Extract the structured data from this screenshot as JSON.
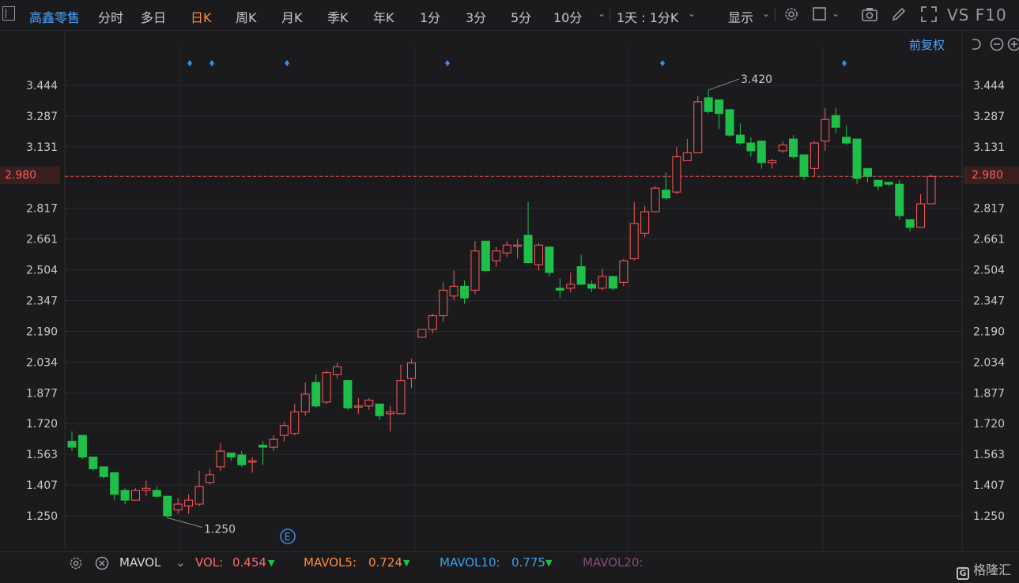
{
  "header": {
    "stock_name": "高鑫零售",
    "tabs": [
      "分时",
      "多日",
      "日K",
      "周K",
      "月K",
      "季K",
      "年K",
      "1分",
      "3分",
      "5分",
      "10分"
    ],
    "active_tab": "日K",
    "period_selector": "1天 : 1分K",
    "display_label": "显示",
    "vs_label": "VS",
    "f10_label": "F10"
  },
  "subbar": {
    "adjust_label": "前复权"
  },
  "current_price_label": "2.980",
  "markers": {
    "high_label": "3.420",
    "low_label": "1.250",
    "event_badge": "E"
  },
  "volume_bar": {
    "indicator": "MAVOL",
    "vol_label": "VOL:",
    "vol_value": "0.454",
    "mavol5_label": "MAVOL5:",
    "mavol5_value": "0.724",
    "mavol10_label": "MAVOL10:",
    "mavol10_value": "0.775",
    "mavol20_label": "MAVOL20:"
  },
  "watermark": "格隆汇",
  "colors": {
    "up": "#ff5a5a",
    "down": "#1fbf4a",
    "accent": "#ff8a3d",
    "link": "#4aa3ff"
  },
  "chart_data": {
    "type": "candlestick",
    "y_ticks": [
      "3.444",
      "3.287",
      "3.131",
      "2.980",
      "2.817",
      "2.661",
      "2.504",
      "2.347",
      "2.190",
      "2.034",
      "1.877",
      "1.720",
      "1.563",
      "1.407",
      "1.250"
    ],
    "ylim": [
      1.15,
      3.55
    ],
    "current_price": 2.98,
    "candles": [
      {
        "o": 1.63,
        "h": 1.68,
        "l": 1.58,
        "c": 1.6
      },
      {
        "o": 1.66,
        "h": 1.66,
        "l": 1.54,
        "c": 1.55
      },
      {
        "o": 1.55,
        "h": 1.55,
        "l": 1.48,
        "c": 1.49
      },
      {
        "o": 1.5,
        "h": 1.5,
        "l": 1.44,
        "c": 1.45
      },
      {
        "o": 1.47,
        "h": 1.47,
        "l": 1.33,
        "c": 1.36
      },
      {
        "o": 1.38,
        "h": 1.39,
        "l": 1.31,
        "c": 1.33
      },
      {
        "o": 1.33,
        "h": 1.39,
        "l": 1.33,
        "c": 1.38
      },
      {
        "o": 1.38,
        "h": 1.43,
        "l": 1.35,
        "c": 1.39
      },
      {
        "o": 1.38,
        "h": 1.4,
        "l": 1.34,
        "c": 1.35
      },
      {
        "o": 1.35,
        "h": 1.35,
        "l": 1.24,
        "c": 1.25
      },
      {
        "o": 1.28,
        "h": 1.34,
        "l": 1.26,
        "c": 1.31
      },
      {
        "o": 1.3,
        "h": 1.36,
        "l": 1.26,
        "c": 1.33
      },
      {
        "o": 1.31,
        "h": 1.48,
        "l": 1.3,
        "c": 1.4
      },
      {
        "o": 1.42,
        "h": 1.49,
        "l": 1.41,
        "c": 1.46
      },
      {
        "o": 1.5,
        "h": 1.62,
        "l": 1.48,
        "c": 1.58
      },
      {
        "o": 1.57,
        "h": 1.57,
        "l": 1.53,
        "c": 1.55
      },
      {
        "o": 1.56,
        "h": 1.58,
        "l": 1.5,
        "c": 1.51
      },
      {
        "o": 1.53,
        "h": 1.55,
        "l": 1.47,
        "c": 1.53
      },
      {
        "o": 1.61,
        "h": 1.63,
        "l": 1.51,
        "c": 1.6
      },
      {
        "o": 1.6,
        "h": 1.66,
        "l": 1.58,
        "c": 1.64
      },
      {
        "o": 1.66,
        "h": 1.73,
        "l": 1.63,
        "c": 1.71
      },
      {
        "o": 1.67,
        "h": 1.82,
        "l": 1.66,
        "c": 1.78
      },
      {
        "o": 1.78,
        "h": 1.93,
        "l": 1.76,
        "c": 1.87
      },
      {
        "o": 1.93,
        "h": 1.97,
        "l": 1.8,
        "c": 1.81
      },
      {
        "o": 1.83,
        "h": 1.99,
        "l": 1.82,
        "c": 1.98
      },
      {
        "o": 1.97,
        "h": 2.03,
        "l": 1.95,
        "c": 2.01
      },
      {
        "o": 1.94,
        "h": 1.94,
        "l": 1.79,
        "c": 1.8
      },
      {
        "o": 1.81,
        "h": 1.85,
        "l": 1.77,
        "c": 1.81
      },
      {
        "o": 1.81,
        "h": 1.85,
        "l": 1.79,
        "c": 1.84
      },
      {
        "o": 1.82,
        "h": 1.82,
        "l": 1.74,
        "c": 1.76
      },
      {
        "o": 1.77,
        "h": 1.81,
        "l": 1.68,
        "c": 1.78
      },
      {
        "o": 1.77,
        "h": 2.02,
        "l": 1.77,
        "c": 1.94
      },
      {
        "o": 1.95,
        "h": 2.05,
        "l": 1.9,
        "c": 2.03
      },
      {
        "o": 2.16,
        "h": 2.2,
        "l": 2.16,
        "c": 2.2
      },
      {
        "o": 2.2,
        "h": 2.28,
        "l": 2.18,
        "c": 2.27
      },
      {
        "o": 2.27,
        "h": 2.44,
        "l": 2.24,
        "c": 2.4
      },
      {
        "o": 2.37,
        "h": 2.5,
        "l": 2.35,
        "c": 2.42
      },
      {
        "o": 2.42,
        "h": 2.45,
        "l": 2.33,
        "c": 2.36
      },
      {
        "o": 2.4,
        "h": 2.65,
        "l": 2.38,
        "c": 2.6
      },
      {
        "o": 2.65,
        "h": 2.65,
        "l": 2.49,
        "c": 2.5
      },
      {
        "o": 2.55,
        "h": 2.62,
        "l": 2.52,
        "c": 2.6
      },
      {
        "o": 2.59,
        "h": 2.65,
        "l": 2.57,
        "c": 2.63
      },
      {
        "o": 2.63,
        "h": 2.66,
        "l": 2.56,
        "c": 2.63
      },
      {
        "o": 2.68,
        "h": 2.85,
        "l": 2.54,
        "c": 2.54
      },
      {
        "o": 2.53,
        "h": 2.64,
        "l": 2.5,
        "c": 2.63
      },
      {
        "o": 2.62,
        "h": 2.62,
        "l": 2.47,
        "c": 2.49
      },
      {
        "o": 2.41,
        "h": 2.46,
        "l": 2.36,
        "c": 2.4
      },
      {
        "o": 2.41,
        "h": 2.49,
        "l": 2.39,
        "c": 2.43
      },
      {
        "o": 2.52,
        "h": 2.58,
        "l": 2.43,
        "c": 2.43
      },
      {
        "o": 2.43,
        "h": 2.45,
        "l": 2.39,
        "c": 2.41
      },
      {
        "o": 2.41,
        "h": 2.51,
        "l": 2.4,
        "c": 2.47
      },
      {
        "o": 2.47,
        "h": 2.47,
        "l": 2.4,
        "c": 2.41
      },
      {
        "o": 2.44,
        "h": 2.56,
        "l": 2.42,
        "c": 2.55
      },
      {
        "o": 2.56,
        "h": 2.85,
        "l": 2.55,
        "c": 2.74
      },
      {
        "o": 2.69,
        "h": 2.83,
        "l": 2.67,
        "c": 2.8
      },
      {
        "o": 2.8,
        "h": 2.93,
        "l": 2.8,
        "c": 2.92
      },
      {
        "o": 2.91,
        "h": 3.0,
        "l": 2.86,
        "c": 2.87
      },
      {
        "o": 2.9,
        "h": 3.13,
        "l": 2.89,
        "c": 3.08
      },
      {
        "o": 3.06,
        "h": 3.17,
        "l": 3.06,
        "c": 3.1
      },
      {
        "o": 3.1,
        "h": 3.39,
        "l": 3.1,
        "c": 3.36
      },
      {
        "o": 3.38,
        "h": 3.42,
        "l": 3.3,
        "c": 3.31
      },
      {
        "o": 3.37,
        "h": 3.37,
        "l": 3.22,
        "c": 3.3
      },
      {
        "o": 3.32,
        "h": 3.32,
        "l": 3.18,
        "c": 3.19
      },
      {
        "o": 3.19,
        "h": 3.25,
        "l": 3.14,
        "c": 3.15
      },
      {
        "o": 3.15,
        "h": 3.18,
        "l": 3.08,
        "c": 3.11
      },
      {
        "o": 3.16,
        "h": 3.16,
        "l": 3.02,
        "c": 3.05
      },
      {
        "o": 3.05,
        "h": 3.07,
        "l": 3.02,
        "c": 3.06
      },
      {
        "o": 3.11,
        "h": 3.16,
        "l": 3.1,
        "c": 3.14
      },
      {
        "o": 3.17,
        "h": 3.19,
        "l": 3.07,
        "c": 3.08
      },
      {
        "o": 3.09,
        "h": 3.09,
        "l": 2.96,
        "c": 2.98
      },
      {
        "o": 3.02,
        "h": 3.16,
        "l": 2.98,
        "c": 3.15
      },
      {
        "o": 3.16,
        "h": 3.33,
        "l": 3.11,
        "c": 3.27
      },
      {
        "o": 3.29,
        "h": 3.33,
        "l": 3.2,
        "c": 3.23
      },
      {
        "o": 3.18,
        "h": 3.24,
        "l": 3.14,
        "c": 3.15
      },
      {
        "o": 3.17,
        "h": 3.17,
        "l": 2.94,
        "c": 2.97
      },
      {
        "o": 3.02,
        "h": 3.02,
        "l": 2.95,
        "c": 2.98
      },
      {
        "o": 2.96,
        "h": 2.96,
        "l": 2.91,
        "c": 2.93
      },
      {
        "o": 2.95,
        "h": 2.95,
        "l": 2.93,
        "c": 2.94
      },
      {
        "o": 2.94,
        "h": 2.96,
        "l": 2.76,
        "c": 2.78
      },
      {
        "o": 2.76,
        "h": 2.76,
        "l": 2.7,
        "c": 2.72
      },
      {
        "o": 2.72,
        "h": 2.89,
        "l": 2.72,
        "c": 2.84
      },
      {
        "o": 2.84,
        "h": 2.99,
        "l": 2.84,
        "c": 2.98
      }
    ]
  }
}
